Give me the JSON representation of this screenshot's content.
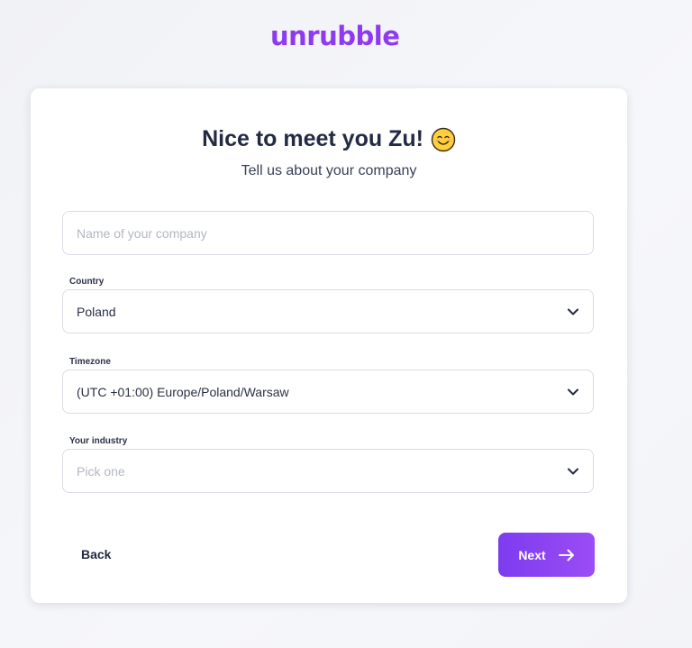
{
  "brand": {
    "logo_text": "unrubble",
    "color": "#8e3bf0"
  },
  "form": {
    "title": "Nice to meet you Zu!",
    "title_icon": "smiling-face-icon",
    "subtitle": "Tell us about your company",
    "company_name": {
      "value": "",
      "placeholder": "Name of your company"
    },
    "country": {
      "label": "Country",
      "value": "Poland"
    },
    "timezone": {
      "label": "Timezone",
      "value": "(UTC +01:00) Europe/Poland/Warsaw"
    },
    "industry": {
      "label": "Your industry",
      "value": "",
      "placeholder": "Pick one"
    }
  },
  "actions": {
    "back_label": "Back",
    "next_label": "Next",
    "accent_color": "#8a43f2"
  }
}
